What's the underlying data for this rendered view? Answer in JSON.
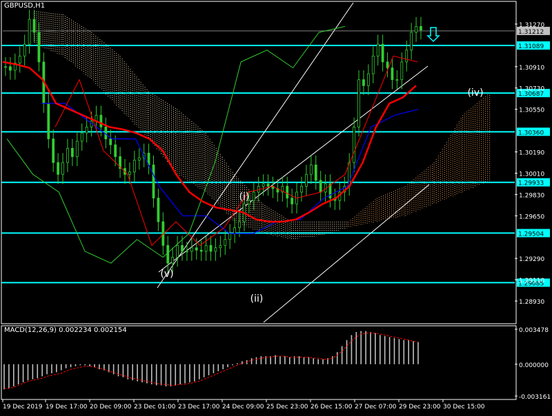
{
  "symbol_label": "GBPUSD,H1",
  "macd_label": "MACD(12,26,9) 0.002234 0.002154",
  "colors": {
    "background": "#000000",
    "grid_frame": "#ffffff",
    "candles": "#32cd32",
    "chikou": "#32cd32",
    "ma_red": "#ff0000",
    "kijun_blue": "#0000ff",
    "hline": "#00ffff",
    "channel": "#ffffff",
    "cloud_bull": "#f5deb3",
    "cloud_bear": "#f4a460",
    "macd_hist": "#c0c0c0",
    "macd_signal": "#ff0000",
    "arrow": "#00ffff"
  },
  "chart_data": [
    {
      "type": "candlestick",
      "title": "GBPUSD,H1",
      "ylim": [
        1.2875,
        1.3145
      ],
      "y_ticks": [
        "1.31270",
        "1.30910",
        "1.30730",
        "1.30550",
        "1.30190",
        "1.30010",
        "1.29830",
        "1.29650",
        "1.29290",
        "1.29110",
        "1.28930"
      ],
      "x_ticks": [
        "19 Dec 2019",
        "19 Dec 17:00",
        "20 Dec 09:00",
        "23 Dec 01:00",
        "23 Dec 17:00",
        "24 Dec 09:00",
        "25 Dec 23:00",
        "26 Dec 15:00",
        "27 Dec 07:00",
        "29 Dec 23:00",
        "30 Dec 15:00"
      ],
      "price_marker": "1.31212",
      "horizontal_levels": [
        {
          "value": 1.31089,
          "label": "1.31089"
        },
        {
          "value": 1.30687,
          "label": "1.30687"
        },
        {
          "value": 1.3036,
          "label": "1.30360"
        },
        {
          "value": 1.29933,
          "label": "1.29933"
        },
        {
          "value": 1.29504,
          "label": "1.29504"
        },
        {
          "value": 1.29085,
          "label": "1.29085"
        }
      ],
      "wave_labels": [
        {
          "text": "(v)",
          "x": "23 Dec 01:00",
          "y": 1.291
        },
        {
          "text": "(i)",
          "x": "24 Dec 09:00",
          "y": 1.2977
        },
        {
          "text": "(ii)",
          "x": "25 Dec 23:00",
          "y": 1.2887
        },
        {
          "text": "(iv)",
          "x": "30 Dec 15:00",
          "y": 1.3065
        }
      ],
      "close_series": [
        1.3091,
        1.3088,
        1.3094,
        1.31,
        1.311,
        1.3131,
        1.312,
        1.3095,
        1.306,
        1.303,
        1.301,
        1.3,
        1.301,
        1.3022,
        1.3015,
        1.3028,
        1.3035,
        1.304,
        1.3045,
        1.305,
        1.304,
        1.303,
        1.3025,
        1.3015,
        1.3005,
        1.3,
        1.3002,
        1.3012,
        1.3014,
        1.3018,
        1.3008,
        1.298,
        1.296,
        1.294,
        1.2925,
        1.293,
        1.294,
        1.2935,
        1.2935,
        1.2938,
        1.2936,
        1.2935,
        1.294,
        1.2935,
        1.2938,
        1.294,
        1.2945,
        1.295,
        1.2955,
        1.296,
        1.2975,
        1.2978,
        1.2985,
        1.299,
        1.2992,
        1.299,
        1.2988,
        1.2985,
        1.299,
        1.298,
        1.2975,
        1.2985,
        1.299,
        1.3,
        1.3008,
        1.2995,
        1.2985,
        1.2992,
        1.298,
        1.2978,
        1.2985,
        1.299,
        1.301,
        1.304,
        1.308,
        1.3075,
        1.3085,
        1.31,
        1.311,
        1.3095,
        1.309,
        1.308,
        1.308,
        1.3095,
        1.3105,
        1.312,
        1.3125,
        1.3122
      ],
      "ma_red": [
        1.3095,
        1.3093,
        1.309,
        1.308,
        1.306,
        1.3055,
        1.305,
        1.3045,
        1.304,
        1.3038,
        1.3035,
        1.303,
        1.302,
        1.3,
        1.2985,
        1.2977,
        1.2972,
        1.297,
        1.2968,
        1.2962,
        1.296,
        1.296,
        1.2962,
        1.2968,
        1.2975,
        1.298,
        1.299,
        1.301,
        1.304,
        1.306,
        1.3065,
        1.3075
      ],
      "kijun_blue": [
        1.306,
        1.306,
        1.3045,
        1.303,
        1.303,
        1.299,
        1.2965,
        1.2965,
        1.295,
        1.295,
        1.296,
        1.2962,
        1.298,
        1.299,
        1.304,
        1.305,
        1.3055
      ],
      "tenkan_red": [
        1.304,
        1.308,
        1.302,
        1.3,
        1.294,
        1.296,
        1.294,
        1.2955,
        1.2985,
        1.299,
        1.298,
        1.2985,
        1.3,
        1.305,
        1.31,
        1.3095
      ],
      "chikou": [
        1.303,
        1.3,
        1.2985,
        1.2935,
        1.2925,
        1.2945,
        1.293,
        1.295,
        1.301,
        1.3095,
        1.3105,
        1.309,
        1.312,
        1.3125
      ],
      "cloud_upper": [
        1.3138,
        1.3135,
        1.312,
        1.31,
        1.307,
        1.3055,
        1.3035,
        1.3,
        1.2975,
        1.296,
        1.296,
        1.296,
        1.298,
        1.299,
        1.301,
        1.305,
        1.307
      ],
      "cloud_lower": [
        1.311,
        1.31,
        1.308,
        1.3055,
        1.303,
        1.3,
        1.2985,
        1.296,
        1.295,
        1.2945,
        1.2948,
        1.2955,
        1.296,
        1.2965,
        1.2975,
        1.2985,
        1.2995
      ]
    },
    {
      "type": "bar",
      "title": "MACD(12,26,9) 0.002234 0.002154",
      "ylim": [
        -0.003161,
        0.003478
      ],
      "y_ticks": [
        "0.003478",
        "0.000000",
        "-0.003161"
      ],
      "histogram": [
        -0.0025,
        -0.0024,
        -0.0022,
        -0.002,
        -0.0018,
        -0.0016,
        -0.0015,
        -0.0014,
        -0.0012,
        -0.001,
        -0.0009,
        -0.0008,
        -0.0006,
        -0.0004,
        -0.0003,
        -0.0002,
        -0.0001,
        -0.0001,
        -0.0002,
        -0.0003,
        -0.0005,
        -0.0006,
        -0.0008,
        -0.001,
        -0.0012,
        -0.0013,
        -0.0015,
        -0.0016,
        -0.0017,
        -0.0018,
        -0.0019,
        -0.002,
        -0.0021,
        -0.0021,
        -0.0022,
        -0.0022,
        -0.0021,
        -0.002,
        -0.0019,
        -0.0018,
        -0.0017,
        -0.0015,
        -0.0013,
        -0.0011,
        -0.0009,
        -0.0007,
        -0.0005,
        -0.0003,
        -0.0001,
        0.0001,
        0.0003,
        0.0004,
        0.0006,
        0.0007,
        0.0008,
        0.0008,
        0.0008,
        0.0009,
        0.0008,
        0.0008,
        0.0007,
        0.0008,
        0.0008,
        0.0007,
        0.0007,
        0.0006,
        0.0005,
        0.0005,
        0.0006,
        0.0008,
        0.0012,
        0.0018,
        0.0024,
        0.0029,
        0.0032,
        0.0033,
        0.0033,
        0.0032,
        0.0031,
        0.0029,
        0.0028,
        0.0027,
        0.0026,
        0.0025,
        0.0024,
        0.0024,
        0.0023,
        0.0022
      ],
      "signal": [
        -0.0024,
        -0.0024,
        -0.0023,
        -0.0021,
        -0.0019,
        -0.0017,
        -0.0016,
        -0.0015,
        -0.0014,
        -0.0012,
        -0.0011,
        -0.001,
        -0.0009,
        -0.0007,
        -0.0005,
        -0.0004,
        -0.0003,
        -0.0002,
        -0.0002,
        -0.0003,
        -0.0004,
        -0.0005,
        -0.0007,
        -0.0008,
        -0.001,
        -0.0011,
        -0.0013,
        -0.0014,
        -0.0015,
        -0.0016,
        -0.0017,
        -0.0018,
        -0.0019,
        -0.002,
        -0.002,
        -0.0021,
        -0.0021,
        -0.002,
        -0.002,
        -0.0019,
        -0.0018,
        -0.0017,
        -0.0015,
        -0.0013,
        -0.0011,
        -0.0009,
        -0.0007,
        -0.0005,
        -0.0003,
        -0.0001,
        0.0001,
        0.0002,
        0.0004,
        0.0005,
        0.0006,
        0.0007,
        0.0007,
        0.0008,
        0.0008,
        0.0008,
        0.0007,
        0.0007,
        0.0007,
        0.0007,
        0.0007,
        0.0006,
        0.0006,
        0.0005,
        0.0005,
        0.0006,
        0.0009,
        0.0013,
        0.0018,
        0.0023,
        0.0027,
        0.003,
        0.0031,
        0.0031,
        0.0031,
        0.003,
        0.0029,
        0.0028,
        0.0027,
        0.0026,
        0.0025,
        0.0024,
        0.0023,
        0.0022
      ]
    }
  ]
}
